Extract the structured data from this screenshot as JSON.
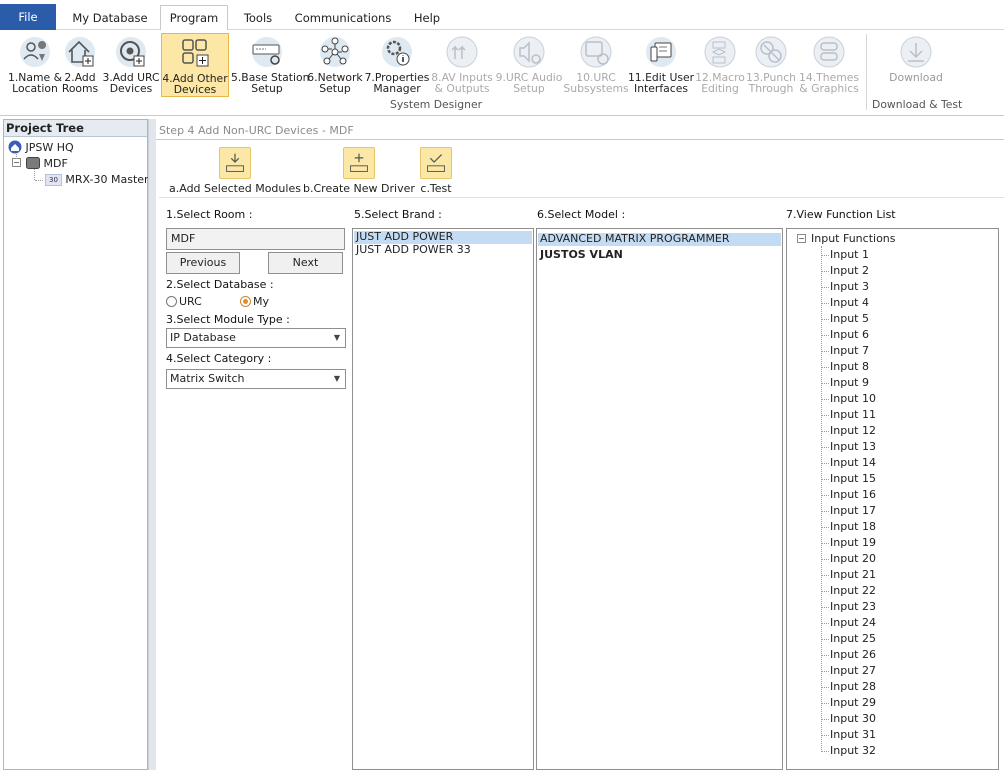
{
  "menu": {
    "file": "File",
    "items": [
      "My Database",
      "Program",
      "Tools",
      "Communications",
      "Help"
    ],
    "active": "Program"
  },
  "ribbon": {
    "buttons": [
      {
        "label": "1.Name &\nLocation",
        "icon": "location-person-icon"
      },
      {
        "label": "2.Add\nRooms",
        "icon": "house-add-icon"
      },
      {
        "label": "3.Add URC\nDevices",
        "icon": "remote-add-icon"
      },
      {
        "label": "4.Add Other\nDevices",
        "icon": "grid-add-icon"
      },
      {
        "label": "5.Base Station\nSetup",
        "icon": "base-station-icon"
      },
      {
        "label": "6.Network\nSetup",
        "icon": "network-icon"
      },
      {
        "label": "7.Properties\nManager",
        "icon": "gear-info-icon"
      },
      {
        "label": "8.AV Inputs\n& Outputs",
        "icon": "av-arrows-icon"
      },
      {
        "label": "9.URC Audio\nSetup",
        "icon": "audio-gear-icon"
      },
      {
        "label": "10.URC\nSubsystems",
        "icon": "subsystems-icon"
      },
      {
        "label": "11.Edit User\nInterfaces",
        "icon": "edit-ui-icon"
      },
      {
        "label": "12.Macro\nEditing",
        "icon": "macro-flow-icon"
      },
      {
        "label": "13.Punch\nThrough",
        "icon": "punch-through-icon"
      },
      {
        "label": "14.Themes\n& Graphics",
        "icon": "themes-icon"
      },
      {
        "label": "Download",
        "icon": "download-icon"
      }
    ],
    "group1": "System Designer",
    "group2": "Download & Test"
  },
  "tree": {
    "header": "Project Tree",
    "root": "JPSW HQ",
    "room": "MDF",
    "device": "MRX-30 Master",
    "device_badge": "30"
  },
  "main": {
    "step_title": "Step 4 Add Non-URC Devices - MDF",
    "tools": [
      "a.Add Selected Modules",
      "b.Create New Driver",
      "c.Test"
    ],
    "select_room_label": "1.Select Room :",
    "room_value": "MDF",
    "previous": "Previous",
    "next": "Next",
    "select_db_label": "2.Select Database :",
    "db_urc": "URC",
    "db_my": "My",
    "module_type_label": "3.Select Module Type :",
    "module_type_value": "IP Database",
    "category_label": "4.Select Category :",
    "category_value": "Matrix Switch",
    "brand_label": "5.Select Brand :",
    "brands": [
      "JUST ADD POWER",
      "JUST ADD POWER 33"
    ],
    "model_label": "6.Select Model :",
    "models": [
      "ADVANCED MATRIX PROGRAMMER",
      "JUSTOS VLAN"
    ],
    "function_label": "7.View Function List",
    "function_root": "Input Functions",
    "functions": [
      "Input 1",
      "Input 2",
      "Input 3",
      "Input 4",
      "Input 5",
      "Input 6",
      "Input 7",
      "Input 8",
      "Input 9",
      "Input 10",
      "Input 11",
      "Input 12",
      "Input 13",
      "Input 14",
      "Input 15",
      "Input 16",
      "Input 17",
      "Input 18",
      "Input 19",
      "Input 20",
      "Input 21",
      "Input 22",
      "Input 23",
      "Input 24",
      "Input 25",
      "Input 26",
      "Input 27",
      "Input 28",
      "Input 29",
      "Input 30",
      "Input 31",
      "Input 32"
    ]
  }
}
